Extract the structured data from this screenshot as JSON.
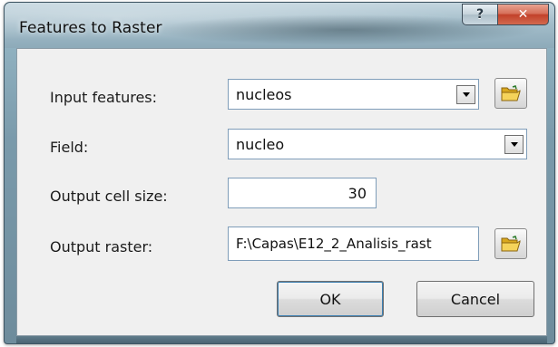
{
  "window": {
    "title": "Features to Raster",
    "help_label": "?",
    "close_label": "✕"
  },
  "form": {
    "input_features": {
      "label": "Input features:",
      "value": "nucleos",
      "icon": "open-folder-icon"
    },
    "field": {
      "label": "Field:",
      "value": "nucleo"
    },
    "cell_size": {
      "label": "Output cell size:",
      "value": "30"
    },
    "output_raster": {
      "label": "Output raster:",
      "value": "F:\\Capas\\E12_2_Analisis_rast",
      "icon": "open-folder-icon"
    }
  },
  "buttons": {
    "ok": "OK",
    "cancel": "Cancel"
  }
}
